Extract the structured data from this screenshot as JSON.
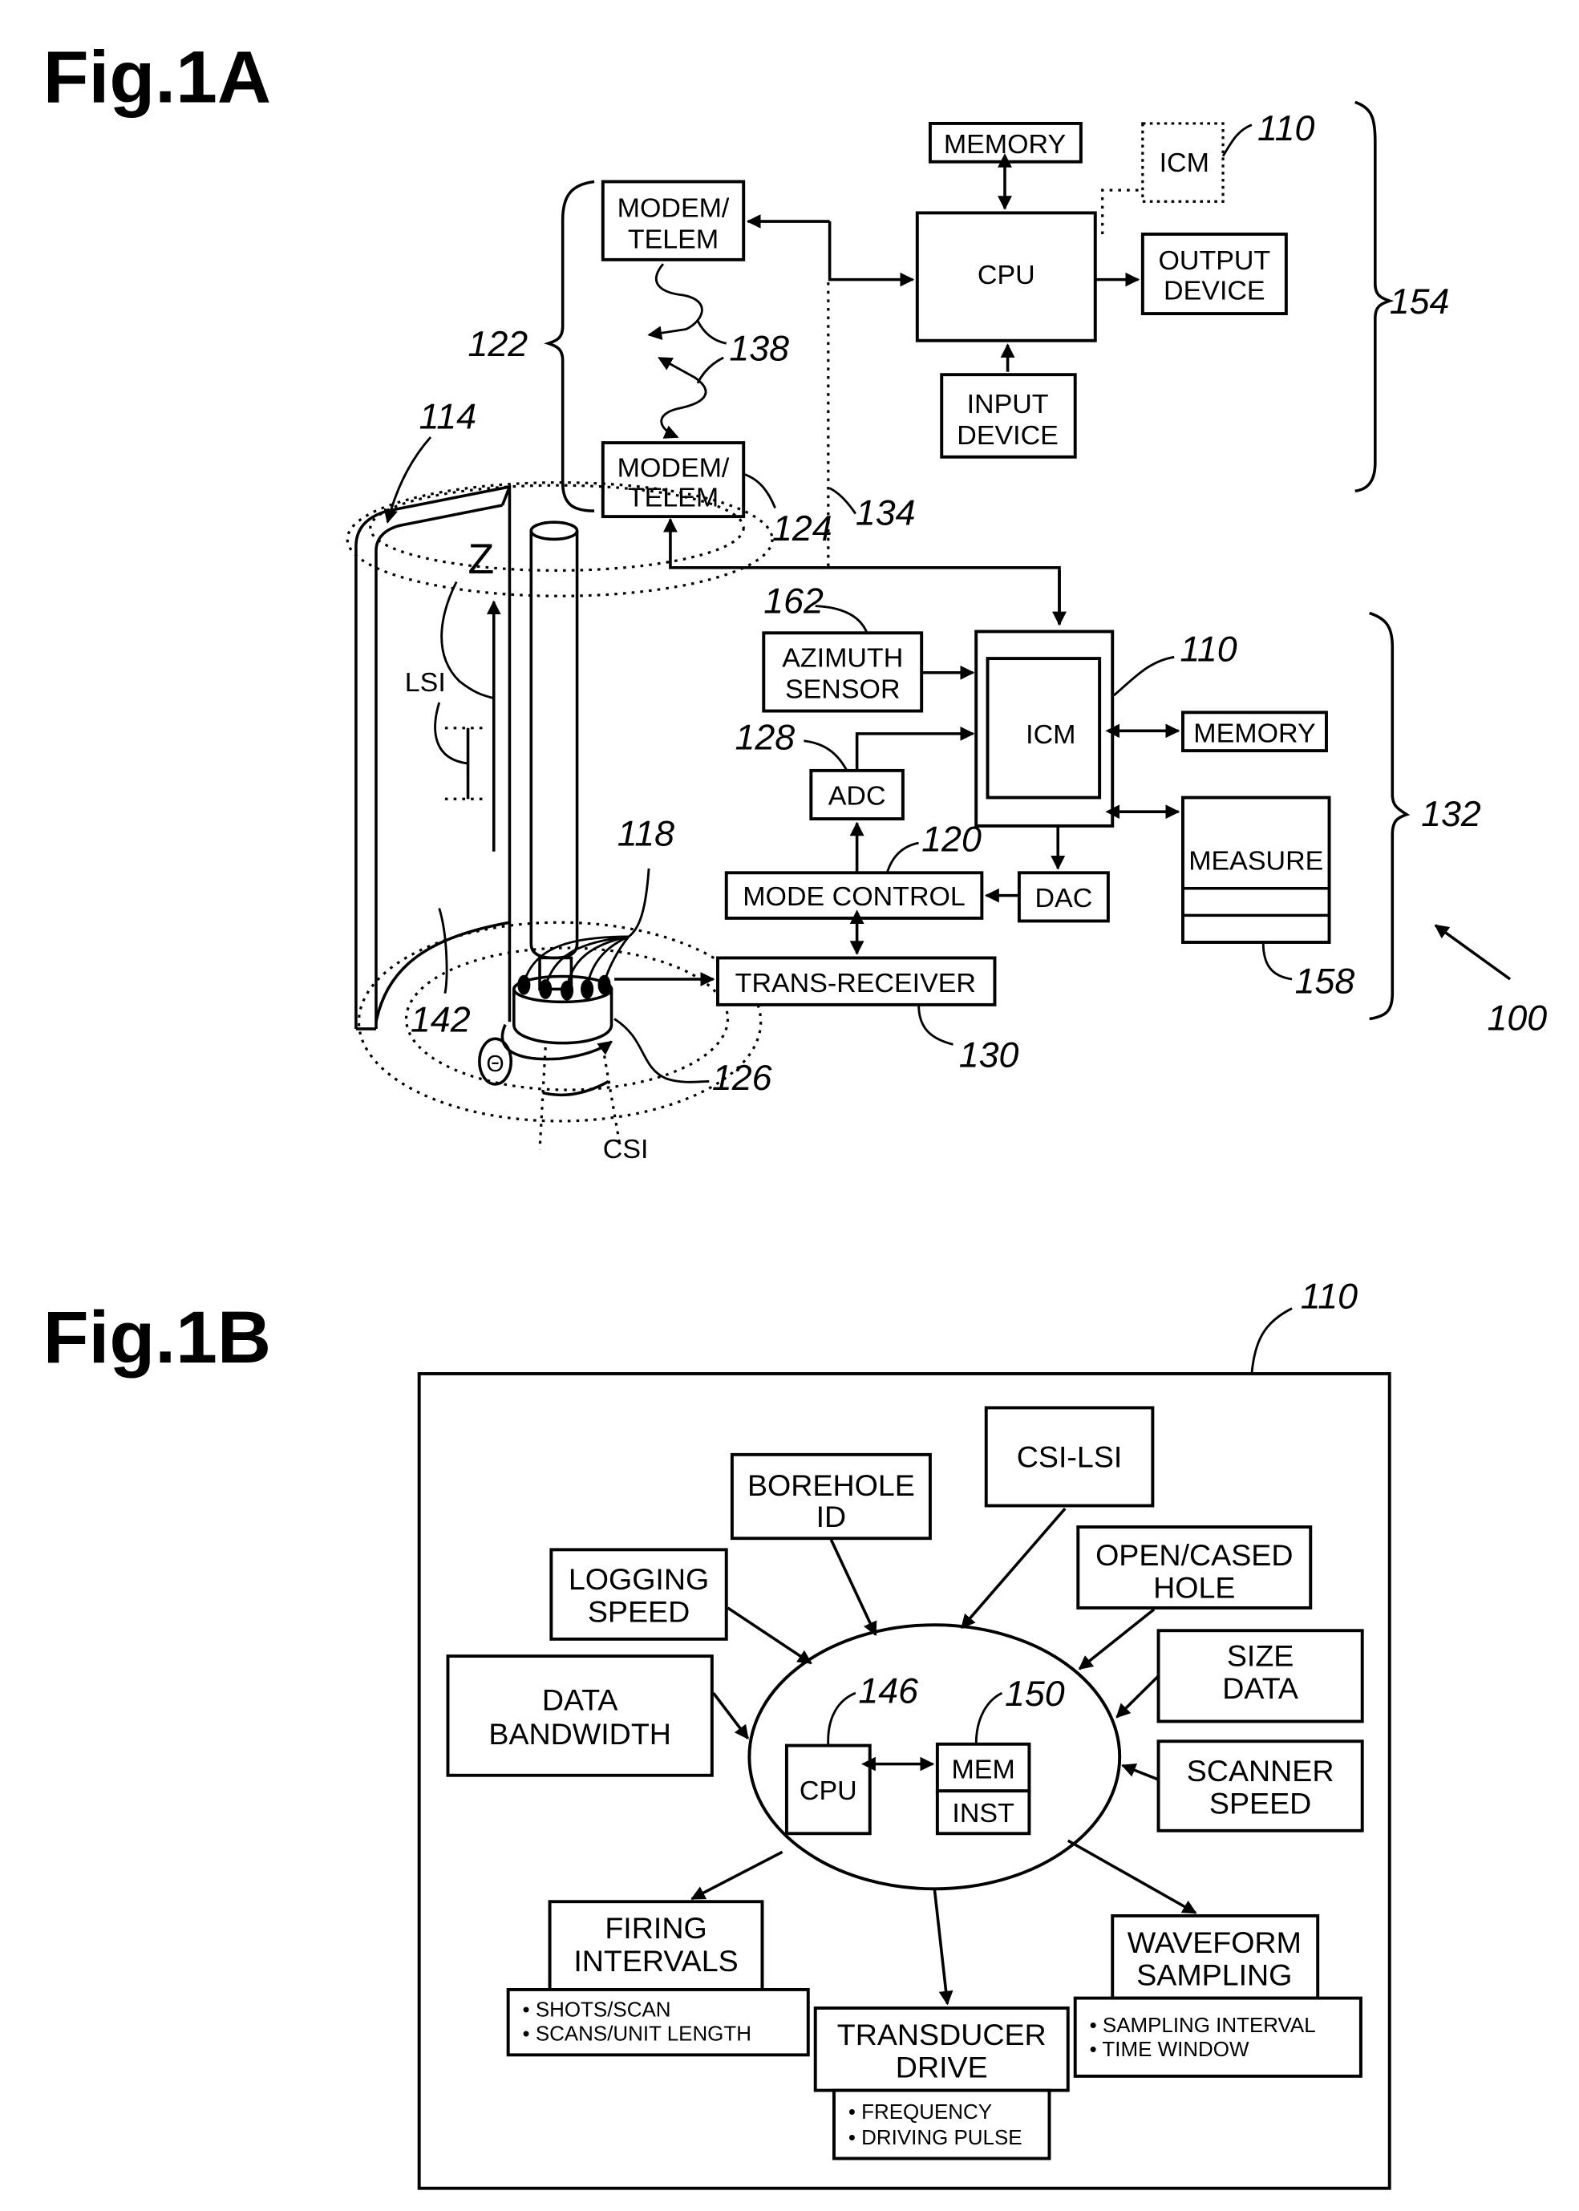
{
  "figures": {
    "fig1a": {
      "title": "Fig.1A",
      "blocks": {
        "memory_top": "MEMORY",
        "icm_dotted": "ICM",
        "modem_top": [
          "MODEM/",
          "TELEM"
        ],
        "cpu": "CPU",
        "output_device": [
          "OUTPUT",
          "DEVICE"
        ],
        "input_device": [
          "INPUT",
          "DEVICE"
        ],
        "modem_bottom": [
          "MODEM/",
          "TELEM"
        ],
        "azimuth_sensor": [
          "AZIMUTH",
          "SENSOR"
        ],
        "icm": "ICM",
        "memory_tool": "MEMORY",
        "adc": "ADC",
        "measure": "MEASURE",
        "mode_control": "MODE CONTROL",
        "dac": "DAC",
        "trans_receiver": "TRANS-RECEIVER"
      },
      "labels": {
        "z_axis": "Z",
        "lsi": "LSI",
        "csi": "CSI",
        "theta": "Θ"
      },
      "refs": {
        "r110_top": "110",
        "r154": "154",
        "r122": "122",
        "r138": "138",
        "r114": "114",
        "r124": "124",
        "r134": "134",
        "r162": "162",
        "r110_mid": "110",
        "r128": "128",
        "r132": "132",
        "r118": "118",
        "r120": "120",
        "r158": "158",
        "r142": "142",
        "r126": "126",
        "r130": "130",
        "r100": "100"
      }
    },
    "fig1b": {
      "title": "Fig.1B",
      "ref_box": "110",
      "center": {
        "cpu": "CPU",
        "mem": "MEM",
        "inst": "INST",
        "ref_cpu": "146",
        "ref_mem": "150"
      },
      "inputs": {
        "csi_lsi": [
          "CSI-LSI"
        ],
        "borehole_id": [
          "BOREHOLE",
          "ID"
        ],
        "logging_speed": [
          "LOGGING",
          "SPEED"
        ],
        "open_cased_hole": [
          "OPEN/CASED",
          "HOLE"
        ],
        "data_bandwidth": [
          "DATA",
          "BANDWIDTH"
        ],
        "size_data": [
          "SIZE",
          "DATA"
        ],
        "scanner_speed": [
          "SCANNER",
          "SPEED"
        ]
      },
      "outputs": {
        "firing_intervals": {
          "title": [
            "FIRING",
            "INTERVALS"
          ],
          "items": [
            "• SHOTS/SCAN",
            "• SCANS/UNIT LENGTH"
          ]
        },
        "transducer_drive": {
          "title": [
            "TRANSDUCER",
            "DRIVE"
          ],
          "items": [
            "• FREQUENCY",
            "• DRIVING PULSE"
          ]
        },
        "waveform_sampling": {
          "title": [
            "WAVEFORM",
            "SAMPLING"
          ],
          "items": [
            "• SAMPLING INTERVAL",
            "• TIME WINDOW"
          ]
        }
      }
    }
  }
}
